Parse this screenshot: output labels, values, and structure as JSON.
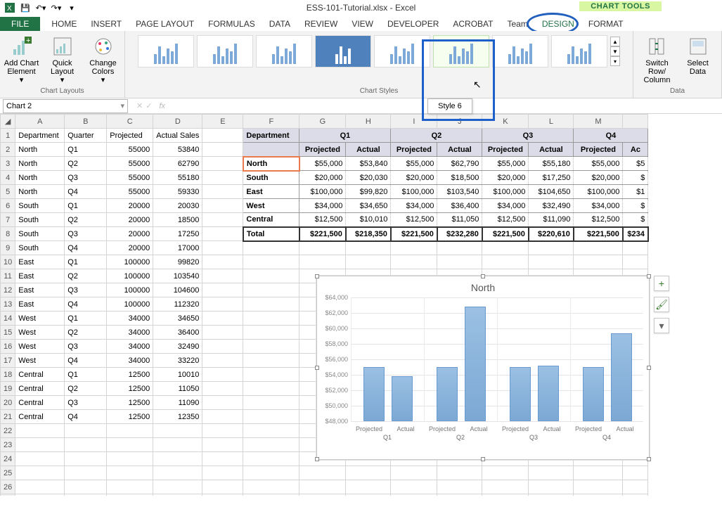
{
  "chart_data": {
    "type": "bar",
    "title": "North",
    "categories": [
      "Q1",
      "Q2",
      "Q3",
      "Q4"
    ],
    "sub": [
      "Projected",
      "Actual"
    ],
    "series": [
      {
        "name": "Q1",
        "values": [
          55000,
          53840
        ]
      },
      {
        "name": "Q2",
        "values": [
          55000,
          62790
        ]
      },
      {
        "name": "Q3",
        "values": [
          55000,
          55180
        ]
      },
      {
        "name": "Q4",
        "values": [
          55000,
          59330
        ]
      }
    ],
    "ylim": [
      48000,
      64000
    ],
    "yticks": [
      "$48,000",
      "$50,000",
      "$52,000",
      "$54,000",
      "$56,000",
      "$58,000",
      "$60,000",
      "$62,000",
      "$64,000"
    ]
  },
  "title": "ESS-101-Tutorial.xlsx - Excel",
  "chart_tools": "CHART TOOLS",
  "tooltip_style6": "Style 6",
  "tabs": [
    "FILE",
    "HOME",
    "INSERT",
    "PAGE LAYOUT",
    "FORMULAS",
    "DATA",
    "REVIEW",
    "VIEW",
    "DEVELOPER",
    "ACROBAT",
    "Team",
    "DESIGN",
    "FORMAT"
  ],
  "ribbon": {
    "layouts_group": "Chart Layouts",
    "styles_group": "Chart Styles",
    "data_group": "Data",
    "add_element": "Add Chart Element",
    "quick_layout": "Quick Layout",
    "change_colors": "Change Colors",
    "switch": "Switch Row/ Column",
    "select": "Select Data"
  },
  "namebox": "Chart 2",
  "colHeaders": [
    "A",
    "B",
    "C",
    "D",
    "E",
    "F",
    "G",
    "H",
    "I",
    "J",
    "K",
    "L",
    "M",
    ""
  ],
  "leftHeader": [
    "Department",
    "Quarter",
    "Projected",
    "Actual Sales"
  ],
  "leftRows": [
    [
      "North",
      "Q1",
      "55000",
      "53840"
    ],
    [
      "North",
      "Q2",
      "55000",
      "62790"
    ],
    [
      "North",
      "Q3",
      "55000",
      "55180"
    ],
    [
      "North",
      "Q4",
      "55000",
      "59330"
    ],
    [
      "South",
      "Q1",
      "20000",
      "20030"
    ],
    [
      "South",
      "Q2",
      "20000",
      "18500"
    ],
    [
      "South",
      "Q3",
      "20000",
      "17250"
    ],
    [
      "South",
      "Q4",
      "20000",
      "17000"
    ],
    [
      "East",
      "Q1",
      "100000",
      "99820"
    ],
    [
      "East",
      "Q2",
      "100000",
      "103540"
    ],
    [
      "East",
      "Q3",
      "100000",
      "104600"
    ],
    [
      "East",
      "Q4",
      "100000",
      "112320"
    ],
    [
      "West",
      "Q1",
      "34000",
      "34650"
    ],
    [
      "West",
      "Q2",
      "34000",
      "36400"
    ],
    [
      "West",
      "Q3",
      "34000",
      "32490"
    ],
    [
      "West",
      "Q4",
      "34000",
      "33220"
    ],
    [
      "Central",
      "Q1",
      "12500",
      "10010"
    ],
    [
      "Central",
      "Q2",
      "12500",
      "11050"
    ],
    [
      "Central",
      "Q3",
      "12500",
      "11090"
    ],
    [
      "Central",
      "Q4",
      "12500",
      "12350"
    ]
  ],
  "pivot": {
    "corner": "Department",
    "quarters": [
      "Q1",
      "Q2",
      "Q3",
      "Q4"
    ],
    "sub": [
      "Projected",
      "Actual",
      "Projected",
      "Actual",
      "Projected",
      "Actual",
      "Projected",
      "Ac"
    ],
    "rows": [
      {
        "name": "North",
        "v": [
          "$55,000",
          "$53,840",
          "$55,000",
          "$62,790",
          "$55,000",
          "$55,180",
          "$55,000",
          "$5"
        ]
      },
      {
        "name": "South",
        "v": [
          "$20,000",
          "$20,030",
          "$20,000",
          "$18,500",
          "$20,000",
          "$17,250",
          "$20,000",
          "$"
        ]
      },
      {
        "name": "East",
        "v": [
          "$100,000",
          "$99,820",
          "$100,000",
          "$103,540",
          "$100,000",
          "$104,650",
          "$100,000",
          "$1"
        ]
      },
      {
        "name": "West",
        "v": [
          "$34,000",
          "$34,650",
          "$34,000",
          "$36,400",
          "$34,000",
          "$32,490",
          "$34,000",
          "$"
        ]
      },
      {
        "name": "Central",
        "v": [
          "$12,500",
          "$10,010",
          "$12,500",
          "$11,050",
          "$12,500",
          "$11,090",
          "$12,500",
          "$"
        ]
      }
    ],
    "total": {
      "name": "Total",
      "v": [
        "$221,500",
        "$218,350",
        "$221,500",
        "$232,280",
        "$221,500",
        "$220,610",
        "$221,500",
        "$234"
      ]
    }
  }
}
